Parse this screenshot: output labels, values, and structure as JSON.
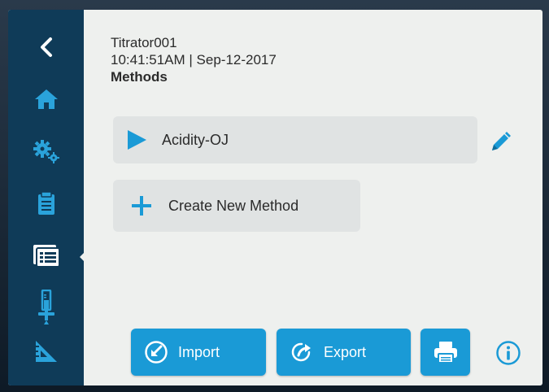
{
  "header": {
    "device_name": "Titrator001",
    "datetime": "10:41:51AM | Sep-12-2017",
    "page_title": "Methods"
  },
  "sidebar": {
    "items": [
      {
        "name": "back",
        "icon": "chevron-left-icon"
      },
      {
        "name": "home",
        "icon": "home-icon"
      },
      {
        "name": "settings",
        "icon": "gears-icon"
      },
      {
        "name": "clipboard",
        "icon": "clipboard-icon"
      },
      {
        "name": "methods",
        "icon": "methods-list-icon",
        "active": true
      },
      {
        "name": "titrate",
        "icon": "burette-icon"
      },
      {
        "name": "calibrate",
        "icon": "set-square-icon"
      }
    ]
  },
  "methods": [
    {
      "label": "Acidity-OJ"
    }
  ],
  "create_method": {
    "label": "Create New Method"
  },
  "buttons": {
    "import_label": "Import",
    "export_label": "Export"
  },
  "colors": {
    "sidebar": "#0f3b58",
    "accent": "#1a9ad6",
    "background": "#eef0ee",
    "row": "#e0e3e3"
  }
}
